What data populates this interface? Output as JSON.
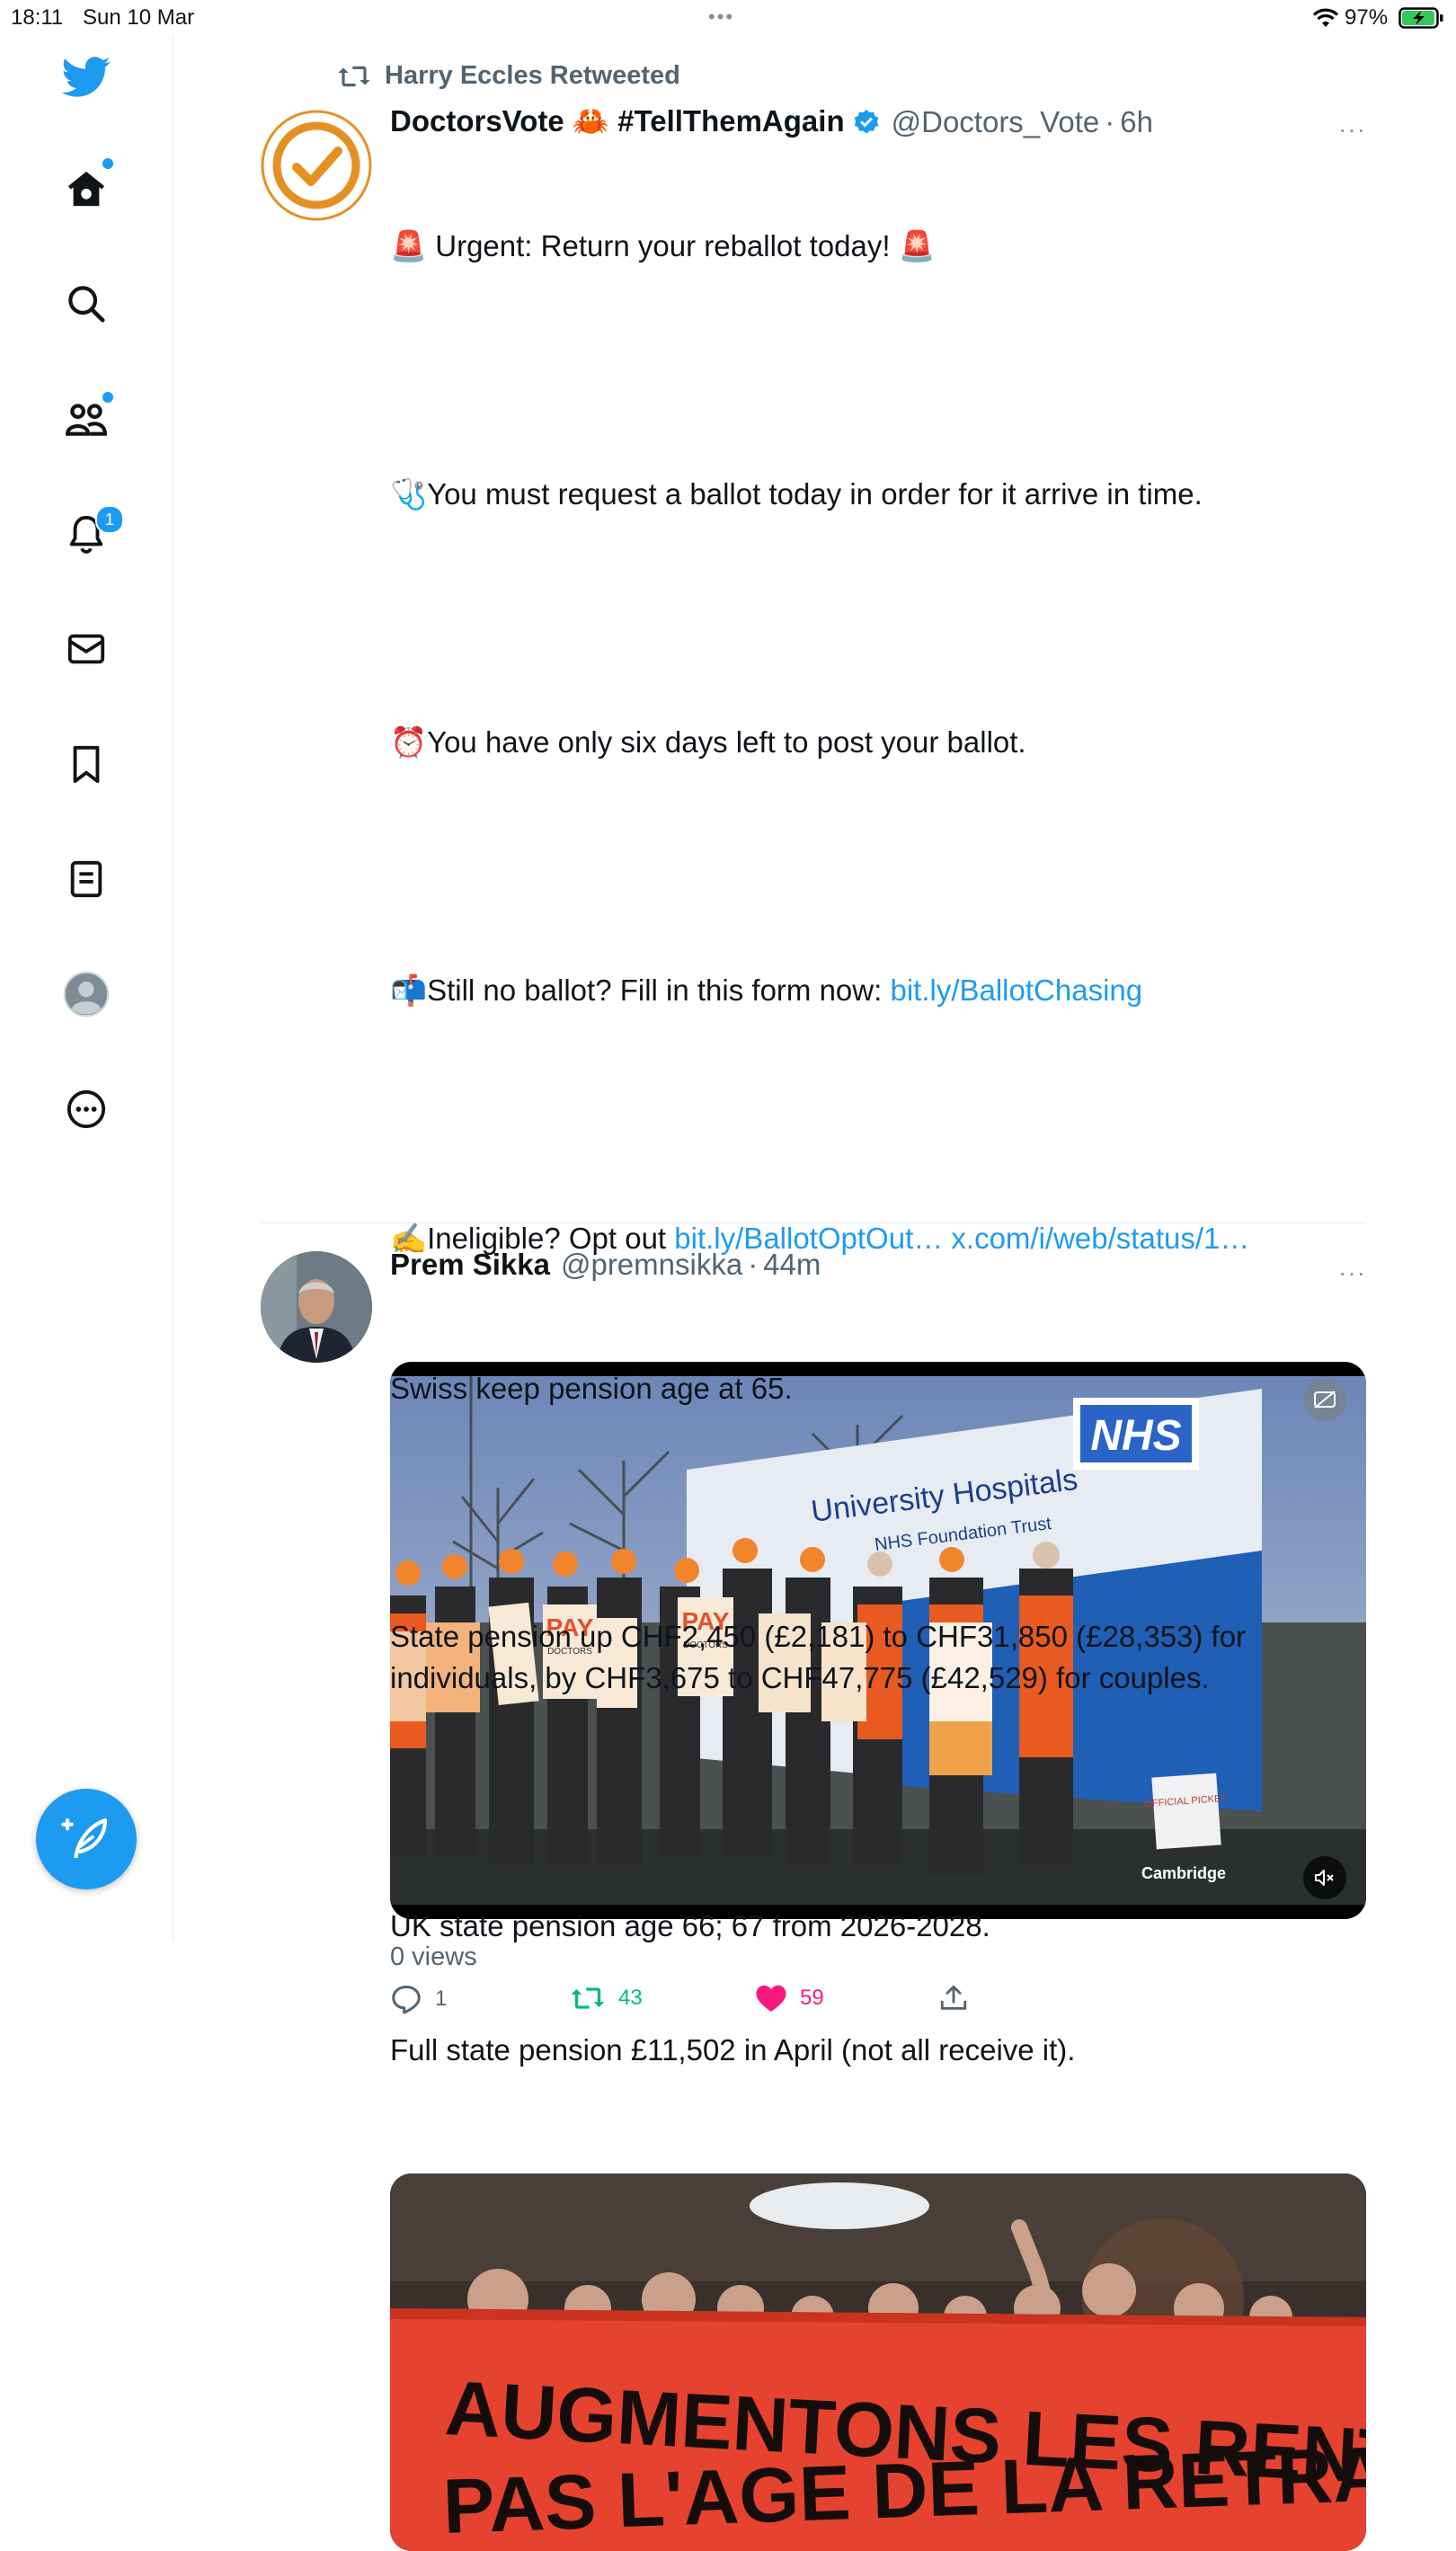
{
  "status_bar": {
    "time": "18:11",
    "date": "Sun 10 Mar",
    "battery_percent": "97%",
    "battery_level": 0.97,
    "battery_charging": true
  },
  "colors": {
    "accent": "#1d9bf0",
    "like": "#f91880",
    "retweet": "#00ba7c",
    "text_secondary": "#536471"
  },
  "sidebar": {
    "items": [
      {
        "name": "home",
        "icon": "home-icon",
        "has_dot": true
      },
      {
        "name": "explore",
        "icon": "search-icon"
      },
      {
        "name": "communities",
        "icon": "communities-icon",
        "has_dot": true
      },
      {
        "name": "notifications",
        "icon": "bell-icon",
        "badge": "1"
      },
      {
        "name": "messages",
        "icon": "mail-icon"
      },
      {
        "name": "bookmarks",
        "icon": "bookmark-icon"
      },
      {
        "name": "lists",
        "icon": "list-icon"
      },
      {
        "name": "profile",
        "icon": "profile-avatar-icon"
      },
      {
        "name": "more",
        "icon": "more-circle-icon"
      }
    ],
    "compose_icon": "compose-feather-icon"
  },
  "tweets": [
    {
      "retweeted_by": "Harry Eccles Retweeted",
      "name": "DoctorsVote 🦀 #TellThemAgain",
      "verified": true,
      "handle": "@Doctors_Vote",
      "separator": "·",
      "time": "6h",
      "more": "···",
      "line1": "🚨 Urgent: Return your reballot today! 🚨",
      "line2": "🩺You must request a ballot today in order for it arrive in time.",
      "line3": "⏰You have only six days left to post your ballot.",
      "line4_text": "📬Still no ballot? Fill in this form now: ",
      "line4_link": "bit.ly/BallotChasing",
      "line5_text": "✍️Ineligible? Opt out ",
      "line5_link1": "bit.ly/BallotOptOut…",
      "line5_link2": "x.com/i/web/status/1…",
      "media": {
        "sign_main": "University Hospitals",
        "sign_sub": "NHS Foundation Trust",
        "nhs_logo": "NHS",
        "placard_1": "PAY",
        "placard_1_sub": "DOCTORS",
        "placard_2": "PAY",
        "placard_2_sub": "DOCTORS",
        "picket_sign": "OFFICIAL PICKET",
        "watermark": "Cambridge",
        "mute_icon": "mute-icon",
        "captions_icon": "captions-icon"
      },
      "views": "0 views",
      "replies": "1",
      "retweets": "43",
      "likes": "59",
      "liked": true
    },
    {
      "name": "Prem Sikka",
      "handle": "@premnsikka",
      "separator": "·",
      "time": "44m",
      "more": "···",
      "line1": "Swiss keep pension age at 65.",
      "line2": "State pension up CHF2,450 (£2,181) to CHF31,850 (£28,353) for individuals, by CHF3,675 to CHF47,775 (£42,529) for couples.",
      "line3": "UK state pension age 66; 67 from 2026-2028.",
      "line4": "Full state pension £11,502 in April (not all receive it).",
      "media": {
        "banner_line1": "AUGMENTONS LES RENTES",
        "banner_line2": "PAS L'AGE DE LA RETRAITE"
      }
    }
  ]
}
